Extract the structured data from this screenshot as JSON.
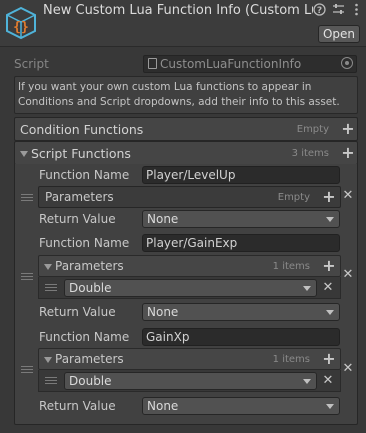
{
  "header": {
    "title": "New Custom Lua Function Info (Custom Lu",
    "open_label": "Open",
    "icon": "lua-script-cube-icon",
    "help_icon": "help-icon",
    "settings_icon": "sliders-icon",
    "menu_icon": "kebab-menu-icon"
  },
  "script": {
    "label": "Script",
    "value": "CustomLuaFunctionInfo"
  },
  "help_text": "If you want your own custom Lua functions to appear in Conditions and Script dropdowns, add their info to this asset.",
  "condition_functions": {
    "label": "Condition Functions",
    "count": "Empty"
  },
  "script_functions": {
    "label": "Script Functions",
    "count": "3 items",
    "items": [
      {
        "function_name_label": "Function Name",
        "function_name": "Player/LevelUp",
        "parameters_label": "Parameters",
        "parameters_count": "Empty",
        "return_value_label": "Return Value",
        "return_value": "None"
      },
      {
        "function_name_label": "Function Name",
        "function_name": "Player/GainExp",
        "parameters_label": "Parameters",
        "parameters_count": "1 items",
        "parameters": [
          "Double"
        ],
        "return_value_label": "Return Value",
        "return_value": "None"
      },
      {
        "function_name_label": "Function Name",
        "function_name": "GainXp",
        "parameters_label": "Parameters",
        "parameters_count": "1 items",
        "parameters": [
          "Double"
        ],
        "return_value_label": "Return Value",
        "return_value": "None"
      }
    ]
  },
  "colors": {
    "background": "#383838",
    "field": "#2b2b2b",
    "text": "#c4c4c4",
    "icon_cyan": "#4fb3d9",
    "icon_orange": "#e07b2e"
  }
}
